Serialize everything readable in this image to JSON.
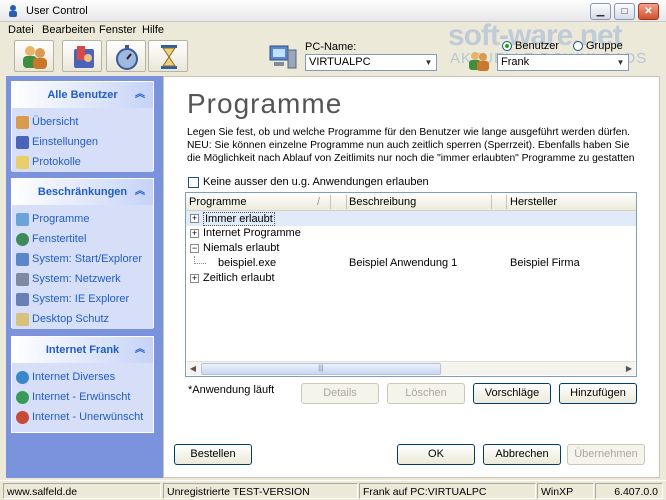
{
  "window": {
    "title": "User Control"
  },
  "menu": [
    "Datei",
    "Bearbeiten",
    "Fenster",
    "Hilfe"
  ],
  "toolbar": {
    "icons": [
      "users-icon",
      "profile-icon",
      "stopwatch-icon",
      "hourglass-icon"
    ]
  },
  "pc": {
    "label": "PC-Name:",
    "value": "VIRTUALPC"
  },
  "target": {
    "benutzer_label": "Benutzer",
    "gruppe_label": "Gruppe",
    "user_value": "Frank"
  },
  "watermark": {
    "main": "soft-ware.net",
    "sub": "AKTUELLE DOWNLOADS"
  },
  "sidebar": {
    "panels": [
      {
        "title": "Alle Benutzer",
        "items": [
          {
            "label": "Übersicht",
            "icon": "users-icon"
          },
          {
            "label": "Einstellungen",
            "icon": "settings-icon"
          },
          {
            "label": "Protokolle",
            "icon": "log-icon"
          }
        ]
      },
      {
        "title": "Beschränkungen",
        "items": [
          {
            "label": "Programme",
            "icon": "programs-icon"
          },
          {
            "label": "Fenstertitel",
            "icon": "window-title-icon"
          },
          {
            "label": "System: Start/Explorer",
            "icon": "start-explorer-icon"
          },
          {
            "label": "System: Netzwerk",
            "icon": "network-icon"
          },
          {
            "label": "System: IE Explorer",
            "icon": "ie-icon"
          },
          {
            "label": "Desktop Schutz",
            "icon": "desktop-icon"
          }
        ]
      },
      {
        "title": "Internet Frank",
        "items": [
          {
            "label": "Internet Diverses",
            "icon": "globe-icon"
          },
          {
            "label": "Internet - Erwünscht",
            "icon": "globe-allowed-icon"
          },
          {
            "label": "Internet - Unerwünscht",
            "icon": "globe-blocked-icon"
          }
        ]
      }
    ]
  },
  "main": {
    "heading": "Programme",
    "description": "Legen Sie fest, ob und welche Programme für den Benutzer wie lange ausgeführt werden dürfen. NEU: Sie können einzelne Programme nun auch zeitlich sperren (Sperrzeit). Ebenfalls haben Sie die Möglichkeit nach Ablauf von Zeitlimits nur noch die \"immer erlaubten\" Programme zu gestatten (im Bereich",
    "checkbox_label": "Keine ausser den u.g. Anwendungen erlauben",
    "columns": [
      "Programme",
      "Beschreibung",
      "Hersteller"
    ],
    "rows": [
      {
        "label": "Immer erlaubt",
        "expander": "+",
        "desc": "",
        "maker": ""
      },
      {
        "label": "Internet Programme",
        "expander": "+",
        "desc": "",
        "maker": ""
      },
      {
        "label": "Niemals erlaubt",
        "expander": "−",
        "desc": "",
        "maker": ""
      },
      {
        "label": "beispiel.exe",
        "expander": "",
        "desc": "Beispiel Anwendung 1",
        "maker": "Beispiel Firma"
      },
      {
        "label": "Zeitlich erlaubt",
        "expander": "+",
        "desc": "",
        "maker": ""
      }
    ],
    "note": "*Anwendung läuft",
    "buttons": {
      "details": "Details",
      "loeschen": "Löschen",
      "vorschlaege": "Vorschläge",
      "hinzufuegen": "Hinzufügen"
    }
  },
  "footer_buttons": {
    "bestellen": "Bestellen",
    "ok": "OK",
    "abbrechen": "Abbrechen",
    "uebernehmen": "Übernehmen"
  },
  "status": {
    "site": "www.salfeld.de",
    "version": "Unregistrierte TEST-VERSION",
    "target": "Frank auf PC:VIRTUALPC",
    "os": "WinXP",
    "build": "6.407.0.0"
  }
}
